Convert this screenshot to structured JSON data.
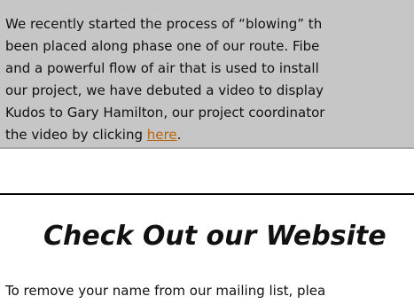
{
  "news": {
    "lines": [
      "We recently started the process of “blowing” th",
      "been placed along phase one of our route.  Fibe",
      "and a powerful flow of air that is used to install",
      "our project, we have debuted a video to display",
      "Kudos to Gary Hamilton, our project coordinator"
    ],
    "last_line_prefix": "the video by clicking ",
    "link_text": "here",
    "last_line_suffix": "."
  },
  "website": {
    "heading": "Check Out our Website"
  },
  "footer": {
    "text": "To remove your name from our mailing list, plea"
  },
  "colors": {
    "news_background": "#c6c6c6",
    "link": "#b8640a",
    "text": "#111111"
  }
}
